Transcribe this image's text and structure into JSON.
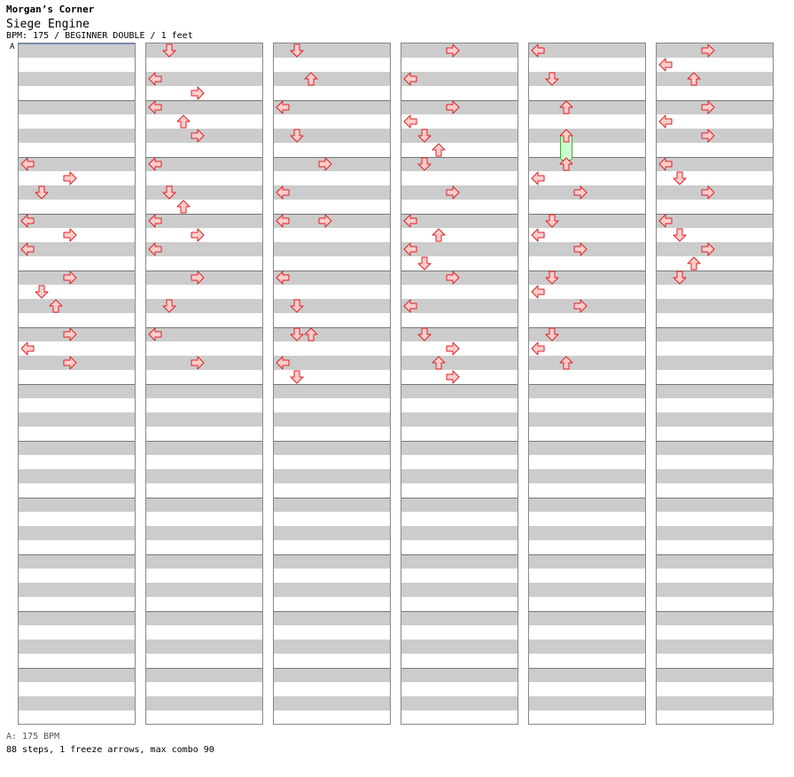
{
  "header": {
    "site_title": "Morgan’s Corner",
    "song_title": "Siege Engine",
    "chart_info": "BPM: 175 / BEGINNER DOUBLE / 1 feet",
    "bpm_marker": "A"
  },
  "footer": {
    "bpm_legend": "A: 175 BPM",
    "summary": "88 steps, 1 freeze arrows, max combo 90"
  },
  "colors": {
    "note_fill": "#ffcccc",
    "note_stroke": "#dd2222",
    "freeze_fill": "#ccffcc",
    "freeze_stroke": "#44aa44",
    "stripe_dark": "#cccccc",
    "stripe_light": "#ffffff"
  },
  "chart_data": {
    "type": "table",
    "rows_per_column": 24,
    "column_count": 6,
    "columns": [
      {
        "notes": [
          {
            "row": 8,
            "dir": "left"
          },
          {
            "row": 9,
            "dir": "right"
          },
          {
            "row": 10,
            "dir": "down"
          },
          {
            "row": 12,
            "dir": "left"
          },
          {
            "row": 13,
            "dir": "right"
          },
          {
            "row": 14,
            "dir": "left"
          },
          {
            "row": 16,
            "dir": "right"
          },
          {
            "row": 17,
            "dir": "down"
          },
          {
            "row": 18,
            "dir": "up"
          },
          {
            "row": 20,
            "dir": "right"
          },
          {
            "row": 21,
            "dir": "left"
          },
          {
            "row": 22,
            "dir": "right"
          }
        ]
      },
      {
        "notes": [
          {
            "row": 0,
            "dir": "down"
          },
          {
            "row": 2,
            "dir": "left"
          },
          {
            "row": 3,
            "dir": "right"
          },
          {
            "row": 4,
            "dir": "left"
          },
          {
            "row": 5,
            "dir": "up"
          },
          {
            "row": 6,
            "dir": "right"
          },
          {
            "row": 8,
            "dir": "left"
          },
          {
            "row": 10,
            "dir": "down"
          },
          {
            "row": 11,
            "dir": "up"
          },
          {
            "row": 12,
            "dir": "left"
          },
          {
            "row": 13,
            "dir": "right"
          },
          {
            "row": 14,
            "dir": "left"
          },
          {
            "row": 16,
            "dir": "right"
          },
          {
            "row": 18,
            "dir": "down"
          },
          {
            "row": 20,
            "dir": "left"
          },
          {
            "row": 22,
            "dir": "right"
          }
        ]
      },
      {
        "notes": [
          {
            "row": 0,
            "dir": "down"
          },
          {
            "row": 2,
            "dir": "up"
          },
          {
            "row": 4,
            "dir": "left"
          },
          {
            "row": 6,
            "dir": "down"
          },
          {
            "row": 8,
            "dir": "right"
          },
          {
            "row": 10,
            "dir": "left"
          },
          {
            "row": 12,
            "dir": "right"
          },
          {
            "row": 12,
            "dir": "left"
          },
          {
            "row": 16,
            "dir": "left"
          },
          {
            "row": 18,
            "dir": "down"
          },
          {
            "row": 20,
            "dir": "down"
          },
          {
            "row": 20,
            "dir": "up"
          },
          {
            "row": 22,
            "dir": "left"
          },
          {
            "row": 23,
            "dir": "down"
          }
        ]
      },
      {
        "notes": [
          {
            "row": 0,
            "dir": "right"
          },
          {
            "row": 2,
            "dir": "left"
          },
          {
            "row": 4,
            "dir": "right"
          },
          {
            "row": 5,
            "dir": "left"
          },
          {
            "row": 6,
            "dir": "down"
          },
          {
            "row": 7,
            "dir": "up"
          },
          {
            "row": 8,
            "dir": "down"
          },
          {
            "row": 10,
            "dir": "right"
          },
          {
            "row": 12,
            "dir": "left"
          },
          {
            "row": 13,
            "dir": "up"
          },
          {
            "row": 14,
            "dir": "left"
          },
          {
            "row": 15,
            "dir": "down"
          },
          {
            "row": 16,
            "dir": "right"
          },
          {
            "row": 18,
            "dir": "left"
          },
          {
            "row": 20,
            "dir": "down"
          },
          {
            "row": 21,
            "dir": "right"
          },
          {
            "row": 22,
            "dir": "up"
          },
          {
            "row": 23,
            "dir": "right"
          }
        ]
      },
      {
        "notes": [
          {
            "row": 0,
            "dir": "left"
          },
          {
            "row": 2,
            "dir": "down"
          },
          {
            "row": 4,
            "dir": "up"
          },
          {
            "row": 6,
            "dir": "up",
            "freeze_until": 7.6
          },
          {
            "row": 8,
            "dir": "up"
          },
          {
            "row": 9,
            "dir": "left"
          },
          {
            "row": 10,
            "dir": "right"
          },
          {
            "row": 12,
            "dir": "down"
          },
          {
            "row": 13,
            "dir": "left"
          },
          {
            "row": 14,
            "dir": "right"
          },
          {
            "row": 16,
            "dir": "down"
          },
          {
            "row": 17,
            "dir": "left"
          },
          {
            "row": 18,
            "dir": "right"
          },
          {
            "row": 20,
            "dir": "down"
          },
          {
            "row": 21,
            "dir": "left"
          },
          {
            "row": 22,
            "dir": "up"
          }
        ]
      },
      {
        "notes": [
          {
            "row": 0,
            "dir": "right"
          },
          {
            "row": 1,
            "dir": "left"
          },
          {
            "row": 2,
            "dir": "up"
          },
          {
            "row": 4,
            "dir": "right"
          },
          {
            "row": 5,
            "dir": "left"
          },
          {
            "row": 6,
            "dir": "right"
          },
          {
            "row": 8,
            "dir": "left"
          },
          {
            "row": 9,
            "dir": "down"
          },
          {
            "row": 10,
            "dir": "right"
          },
          {
            "row": 12,
            "dir": "left"
          },
          {
            "row": 13,
            "dir": "down"
          },
          {
            "row": 14,
            "dir": "right"
          },
          {
            "row": 15,
            "dir": "up"
          },
          {
            "row": 16,
            "dir": "down"
          }
        ]
      }
    ]
  }
}
